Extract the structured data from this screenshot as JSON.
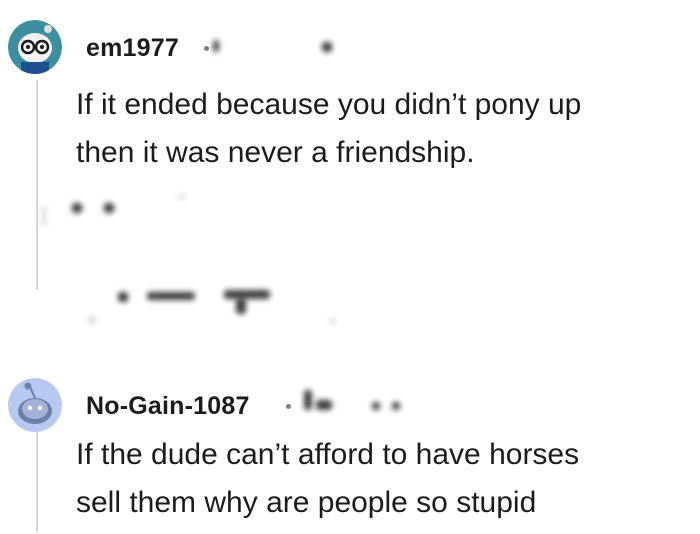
{
  "comments": [
    {
      "username": "em1977",
      "body_lines": [
        "If it ended because you didn’t pony up",
        "then it was never a friendship."
      ]
    },
    {
      "username": "No-Gain-1087",
      "body_lines": [
        "If the dude can’t afford to have horses",
        "sell them why are people so stupid"
      ]
    }
  ],
  "colors": {
    "text": "#1c1c1c",
    "thread_line": "#d6d6d6",
    "avatar1_bg": "#3b8f9e",
    "avatar2_bg": "#b7c9f0"
  },
  "icons": [
    "nerd-snoo-avatar-icon",
    "default-snoo-avatar-icon",
    "blurred-award-icons",
    "blurred-vote-controls"
  ]
}
